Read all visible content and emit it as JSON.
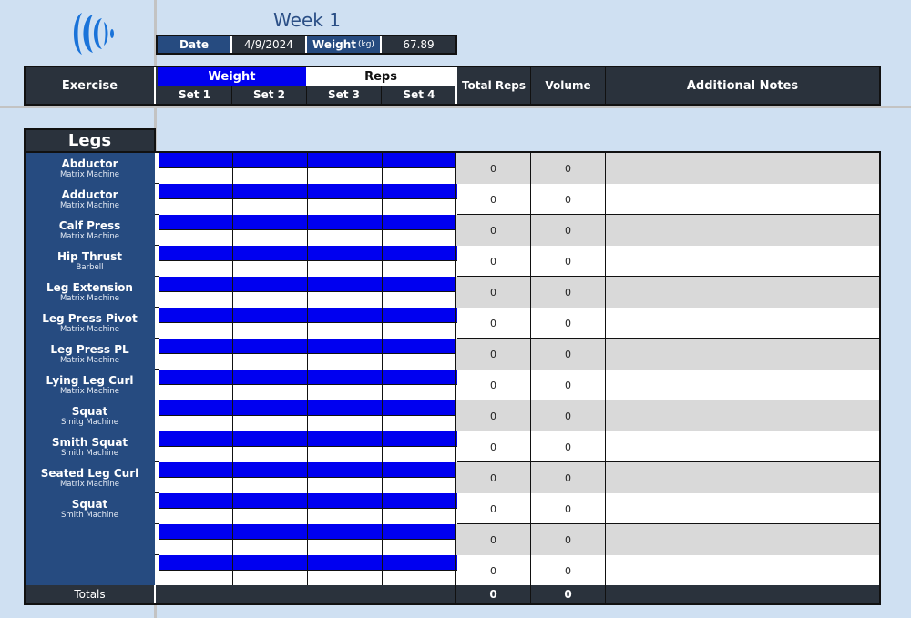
{
  "header": {
    "title": "Week 1",
    "date_label": "Date",
    "date_value": "4/9/2024",
    "weight_label": "Weight",
    "weight_unit": "(kg)",
    "weight_value": "67.89"
  },
  "columns": {
    "exercise": "Exercise",
    "weight_group": "Weight",
    "reps_group": "Reps",
    "sets": [
      "Set 1",
      "Set 2",
      "Set 3",
      "Set 4"
    ],
    "total_reps": "Total Reps",
    "volume": "Volume",
    "notes": "Additional Notes"
  },
  "section": "Legs",
  "rows": [
    {
      "name": "Abductor",
      "equipment": "Matrix Machine",
      "total_reps": "0",
      "volume": "0",
      "notes": ""
    },
    {
      "name": "Adductor",
      "equipment": "Matrix Machine",
      "total_reps": "0",
      "volume": "0",
      "notes": ""
    },
    {
      "name": "Calf Press",
      "equipment": "Matrix Machine",
      "total_reps": "0",
      "volume": "0",
      "notes": ""
    },
    {
      "name": "Hip Thrust",
      "equipment": "Barbell",
      "total_reps": "0",
      "volume": "0",
      "notes": ""
    },
    {
      "name": "Leg Extension",
      "equipment": "Matrix Machine",
      "total_reps": "0",
      "volume": "0",
      "notes": ""
    },
    {
      "name": "Leg Press Pivot",
      "equipment": "Matrix Machine",
      "total_reps": "0",
      "volume": "0",
      "notes": ""
    },
    {
      "name": "Leg Press PL",
      "equipment": "Matrix Machine",
      "total_reps": "0",
      "volume": "0",
      "notes": ""
    },
    {
      "name": "Lying Leg Curl",
      "equipment": "Matrix Machine",
      "total_reps": "0",
      "volume": "0",
      "notes": ""
    },
    {
      "name": "Squat",
      "equipment": "Smitg Machine",
      "total_reps": "0",
      "volume": "0",
      "notes": ""
    },
    {
      "name": "Smith Squat",
      "equipment": "Smith Machine",
      "total_reps": "0",
      "volume": "0",
      "notes": ""
    },
    {
      "name": "Seated Leg Curl",
      "equipment": "Matrix Machine",
      "total_reps": "0",
      "volume": "0",
      "notes": ""
    },
    {
      "name": "Squat",
      "equipment": "Smith Machine",
      "total_reps": "0",
      "volume": "0",
      "notes": ""
    },
    {
      "name": "",
      "equipment": "",
      "total_reps": "0",
      "volume": "0",
      "notes": ""
    },
    {
      "name": "",
      "equipment": "",
      "total_reps": "0",
      "volume": "0",
      "notes": ""
    }
  ],
  "totals": {
    "label": "Totals",
    "total_reps": "0",
    "volume": "0"
  },
  "colors": {
    "background": "#cfe0f2",
    "dark_header": "#2a323c",
    "exercise_blue": "#264b80",
    "weight_blue": "#0000f0",
    "logo_blue": "#1a73d9",
    "shade_gray": "#d9d9d9"
  }
}
